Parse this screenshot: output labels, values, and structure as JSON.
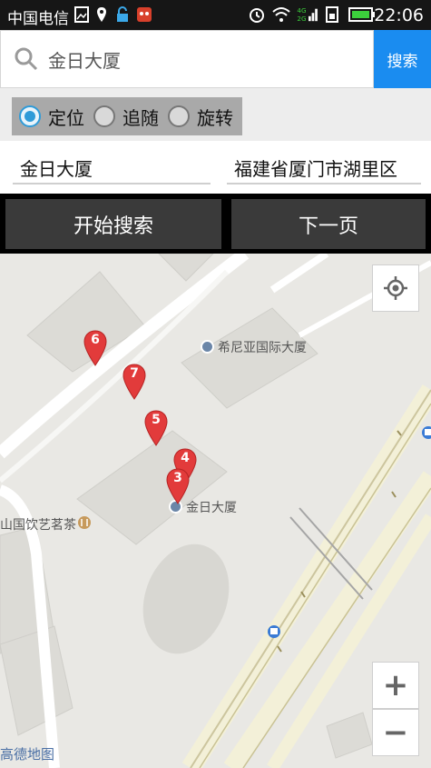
{
  "status_bar": {
    "carrier": "中国电信",
    "time": "22:06"
  },
  "search": {
    "value": "金日大厦",
    "button_label": "搜索"
  },
  "options": {
    "radios": [
      {
        "label": "定位",
        "checked": true
      },
      {
        "label": "追随",
        "checked": false
      },
      {
        "label": "旋转",
        "checked": false
      }
    ]
  },
  "fields": {
    "keyword": "金日大厦",
    "city": "福建省厦门市湖里区"
  },
  "buttons": {
    "start_search": "开始搜索",
    "next_page": "下一页"
  },
  "map": {
    "pois": [
      {
        "name": "希尼亚国际大厦"
      },
      {
        "name": "金日大厦"
      },
      {
        "name": "山国饮艺茗茶"
      }
    ],
    "markers": [
      "6",
      "7",
      "5",
      "4",
      "3"
    ],
    "zoom_in": "+",
    "zoom_out": "−",
    "logo": "高德地图"
  }
}
